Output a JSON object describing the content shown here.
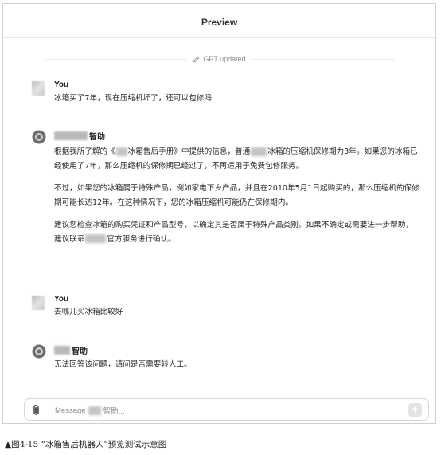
{
  "header": {
    "title": "Preview",
    "update_notice": "GPT updated"
  },
  "conversation": {
    "user_label": "You",
    "bot_label": "智助",
    "message_1_user": "冰箱买了7年，现在压缩机坏了，还可以包修吗",
    "message_2_bot": {
      "p1_a": "根据我所了解的《",
      "p1_b": "冰箱售后手册》中提供的信息，普通",
      "p1_c": "冰箱的压缩机保修期为3年。如果您的冰箱已经使用了7年，那么压缩机的保修期已经过了，不再适用于免费包修服务。",
      "p2": "不过，如果您的冰箱属于特殊产品，例如家电下乡产品，并且在2010年5月1日起购买的，那么压缩机的保修期可能长达12年。在这种情况下，您的冰箱压缩机可能仍在保修期内。",
      "p3_a": "建议您检查冰箱的购买凭证和产品型号，以确定其是否属于特殊产品类别。如果不确定或需要进一步帮助，建议联系",
      "p3_b": "官方服务进行确认。"
    },
    "message_3_user": "去哪儿买冰箱比较好",
    "message_4_bot": "无法回答该问题，请问是否需要转人工。"
  },
  "composer": {
    "placeholder_prefix": "Message",
    "placeholder_suffix": "智助..."
  },
  "caption": "▲图4-15 “冰箱售后机器人”预览测试示意图",
  "icons": {
    "update": "pencil-icon",
    "attach": "paperclip-icon",
    "send": "arrow-up-icon"
  }
}
